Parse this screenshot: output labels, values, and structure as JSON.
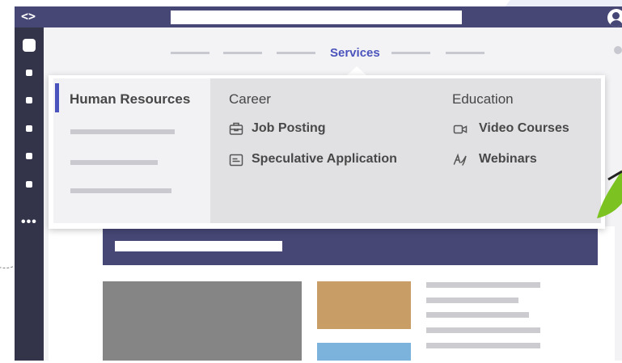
{
  "nav": {
    "active_label": "Services",
    "active_color": "#4b53bc"
  },
  "dropdown": {
    "left_title": "Human Resources",
    "columns": [
      {
        "heading": "Career",
        "items": [
          {
            "label": "Job Posting",
            "icon": "briefcase-icon"
          },
          {
            "label": "Speculative Application",
            "icon": "id-card-icon"
          }
        ]
      },
      {
        "heading": "Education",
        "items": [
          {
            "label": "Video Courses",
            "icon": "video-camera-icon"
          },
          {
            "label": "Webinars",
            "icon": "signature-icon"
          }
        ]
      }
    ]
  },
  "colors": {
    "header": "#464775",
    "rail": "#33344a",
    "accent": "#4b53bc",
    "leaf": "#7cc321"
  }
}
